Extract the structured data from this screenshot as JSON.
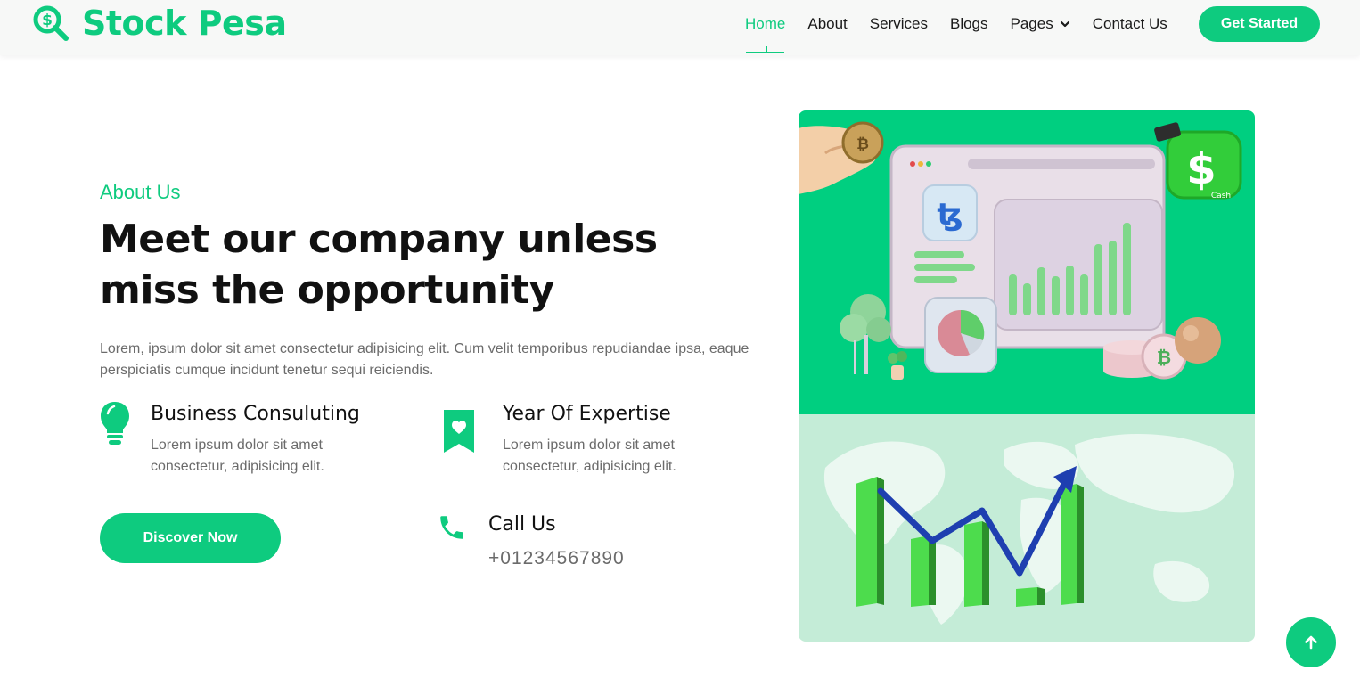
{
  "brand": {
    "name": "Stock Pesa",
    "icon": "search-dollar-icon",
    "color": "#0ecb7f"
  },
  "nav": {
    "items": [
      {
        "label": "Home",
        "active": true
      },
      {
        "label": "About"
      },
      {
        "label": "Services"
      },
      {
        "label": "Blogs"
      },
      {
        "label": "Pages",
        "dropdown": true
      },
      {
        "label": "Contact Us"
      }
    ],
    "cta": "Get Started"
  },
  "about": {
    "kicker": "About Us",
    "headline": "Meet our company unless miss the opportunity",
    "intro": "Lorem, ipsum dolor sit amet consectetur adipisicing elit. Cum velit temporibus repudiandae ipsa, eaque perspiciatis cumque incidunt tenetur sequi reiciendis.",
    "features": [
      {
        "title": "Business Consuluting",
        "text": "Lorem ipsum dolor sit amet consectetur, adipisicing elit.",
        "icon": "lightbulb-icon"
      },
      {
        "title": "Year Of Expertise",
        "text": "Lorem ipsum dolor sit amet consectetur, adipisicing elit.",
        "icon": "bookmark-heart-icon"
      }
    ],
    "call": {
      "title": "Call Us",
      "phone": "+01234567890",
      "icon": "phone-icon"
    },
    "button": "Discover Now"
  },
  "images": {
    "top_cash_label": "Cash"
  },
  "scroll_top_icon": "arrow-up-icon",
  "colors": {
    "accent": "#0ecb7f",
    "image_top_bg": "#00cf80",
    "image_bottom_bg": "#c4ecd7"
  }
}
